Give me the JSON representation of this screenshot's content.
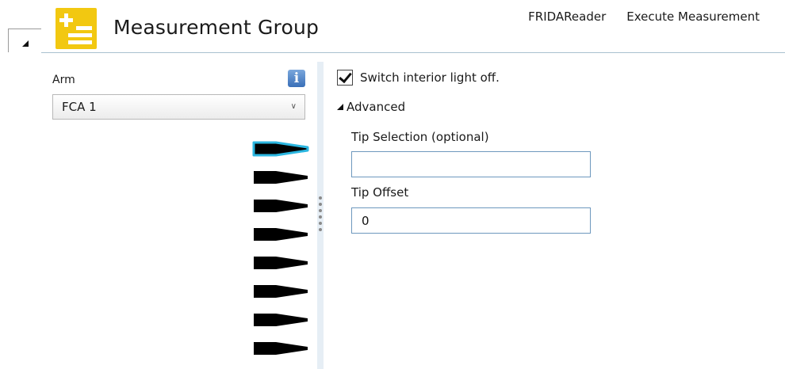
{
  "header": {
    "title": "Measurement Group",
    "icon": "measurement-group-icon",
    "nav": [
      "FRIDAReader",
      "Execute Measurement"
    ],
    "rule_color": "#a9c0cf",
    "icon_color": "#f2c811"
  },
  "left_pane": {
    "arm_label": "Arm",
    "arm_value": "FCA 1",
    "info_glyph": "i",
    "tips": [
      {
        "name": "tip-1",
        "selected": true
      },
      {
        "name": "tip-2",
        "selected": false
      },
      {
        "name": "tip-3",
        "selected": false
      },
      {
        "name": "tip-4",
        "selected": false
      },
      {
        "name": "tip-5",
        "selected": false
      },
      {
        "name": "tip-6",
        "selected": false
      },
      {
        "name": "tip-7",
        "selected": false
      },
      {
        "name": "tip-8",
        "selected": false
      }
    ],
    "selected_tip_color": "#2bb6e0"
  },
  "right_pane": {
    "checkbox_label": "Switch interior light off.",
    "checkbox_checked": true,
    "advanced_label": "Advanced",
    "tip_selection_label": "Tip Selection (optional)",
    "tip_selection_value": "",
    "tip_offset_label": "Tip Offset",
    "tip_offset_value": "0"
  }
}
